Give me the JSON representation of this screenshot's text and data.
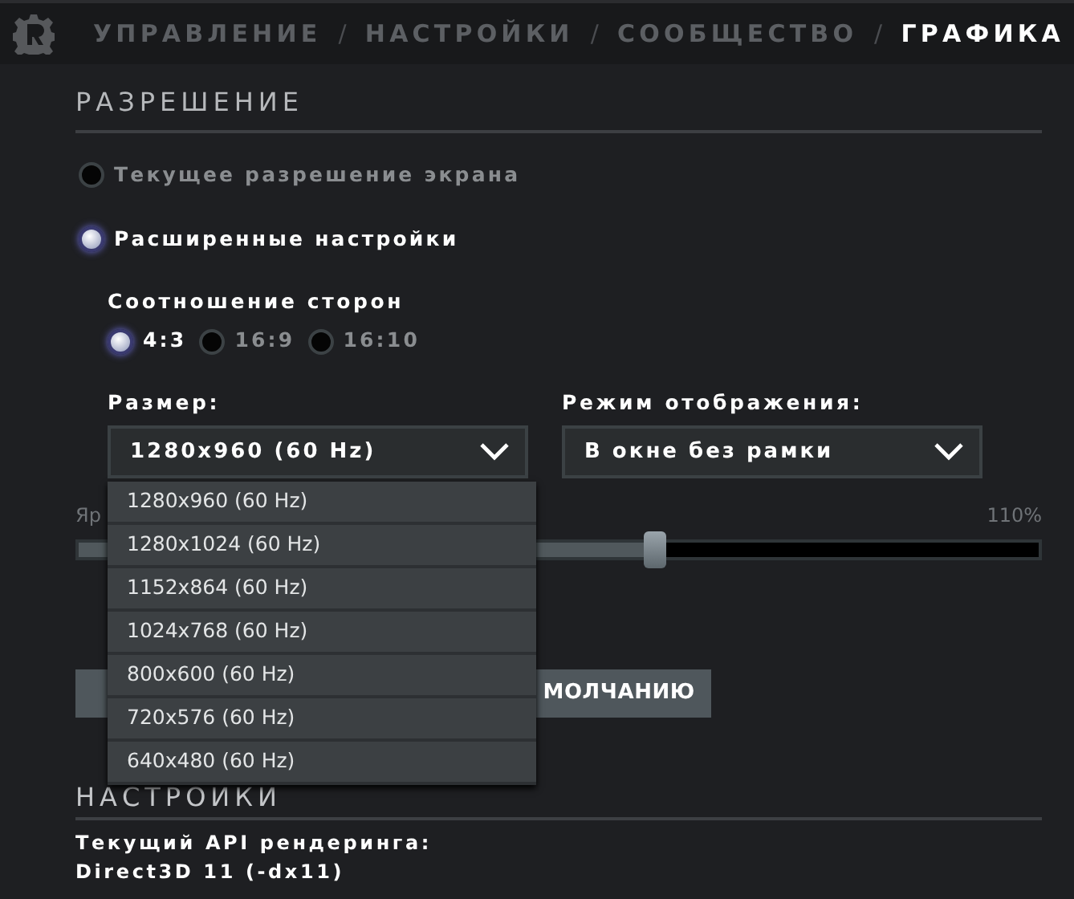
{
  "tabs": [
    {
      "label": "УПРАВЛЕНИЕ",
      "selected": false
    },
    {
      "label": "НАСТРОЙКИ",
      "selected": false
    },
    {
      "label": "СООБЩЕСТВО",
      "selected": false
    },
    {
      "label": "ГРАФИКА",
      "selected": true
    }
  ],
  "tab_separator": "/",
  "resolution": {
    "heading": "РАЗРЕШЕНИЕ",
    "modes": [
      {
        "label": "Текущее разрешение экрана",
        "selected": false
      },
      {
        "label": "Расширенные настройки",
        "selected": true
      }
    ],
    "aspect_label": "Соотношение сторон",
    "aspects": [
      {
        "label": "4:3",
        "selected": true
      },
      {
        "label": "16:9",
        "selected": false
      },
      {
        "label": "16:10",
        "selected": false
      }
    ],
    "size": {
      "label": "Размер:",
      "value": "1280x960 (60 Hz)",
      "expanded": true,
      "options": [
        "1280x960 (60 Hz)",
        "1280x1024 (60 Hz)",
        "1152x864 (60 Hz)",
        "1024x768 (60 Hz)",
        "800x600 (60 Hz)",
        "720x576 (60 Hz)",
        "640x480 (60 Hz)"
      ]
    },
    "display_mode": {
      "label": "Режим отображения:",
      "value": "В окне без рамки"
    },
    "brightness": {
      "label": "Яр",
      "reading": "110%",
      "level": 0.6
    },
    "reset_button": "МОЛЧАНИЮ"
  },
  "settings": {
    "heading": "НАСТРОЙКИ",
    "api_label": "Текущий API рендеринга:",
    "api_value": "Direct3D 11 (-dx11)"
  }
}
